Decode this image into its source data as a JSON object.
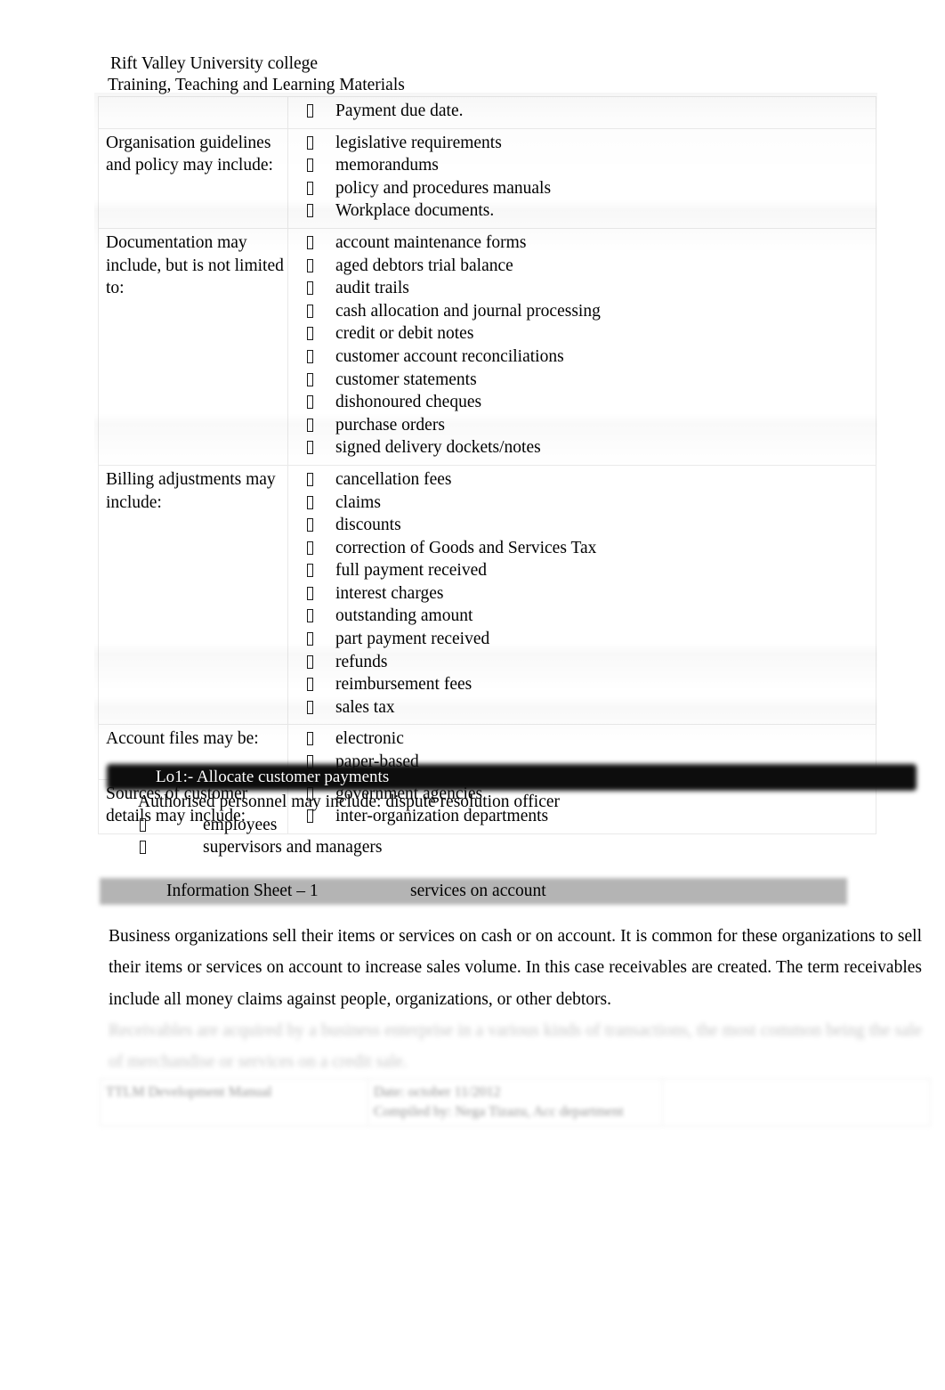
{
  "document": {
    "institution": "Rift Valley University college",
    "subtitle": "Training, Teaching and Learning Materials"
  },
  "range_table": {
    "rows": [
      {
        "label": "",
        "items": [
          "Payment due date."
        ]
      },
      {
        "label": "Organisation guidelines and policy may include:",
        "items": [
          "legislative requirements",
          "memorandums",
          "policy and procedures manuals",
          "Workplace documents."
        ]
      },
      {
        "label": "Documentation may include, but is not limited to:",
        "items": [
          "account maintenance forms",
          "aged debtors trial balance",
          "audit trails",
          "cash allocation and journal processing",
          "credit or debit notes",
          "customer account reconciliations",
          "customer statements",
          "dishonoured cheques",
          "purchase orders",
          "signed delivery dockets/notes"
        ]
      },
      {
        "label": "Billing adjustments may include:",
        "items": [
          "cancellation fees",
          "claims",
          "discounts",
          "correction of Goods and Services Tax",
          "full payment received",
          "interest charges",
          "outstanding amount",
          "part payment received",
          "refunds",
          "reimbursement fees",
          "sales tax"
        ]
      },
      {
        "label": "Account files may be:",
        "items": [
          "electronic",
          "paper-based"
        ]
      },
      {
        "label": "Sources of customer details may include:",
        "items": [
          "government agencies",
          "inter-organization departments"
        ]
      }
    ]
  },
  "lo_banner": {
    "text": "Lo1:- Allocate customer payments"
  },
  "authorised_personnel": {
    "intro": "Authorised personnel  may include: dispute resolution officer",
    "items": [
      "employees",
      "supervisors and managers"
    ]
  },
  "information_sheet": {
    "title": "Information Sheet – 1",
    "topic": "services on account"
  },
  "body": {
    "paragraph": "Business organizations sell their items or services on cash or on account. It is common for these organizations to sell their items or services on account to increase sales volume. In this case receivables are created. The term receivables include all money claims against people, organizations, or other debtors.",
    "faded_paragraph": "Receivables are acquired by a business enterprise in a various kinds of transactions, the most common being the sale of merchandise or services on a credit sale."
  },
  "footer": {
    "col1": "TTLM Development Manual",
    "col2_line1": "Date:  october   11/2012",
    "col2_line2": "Compiled by:  Nega Tizazu,   Acc department",
    "col3": ""
  }
}
